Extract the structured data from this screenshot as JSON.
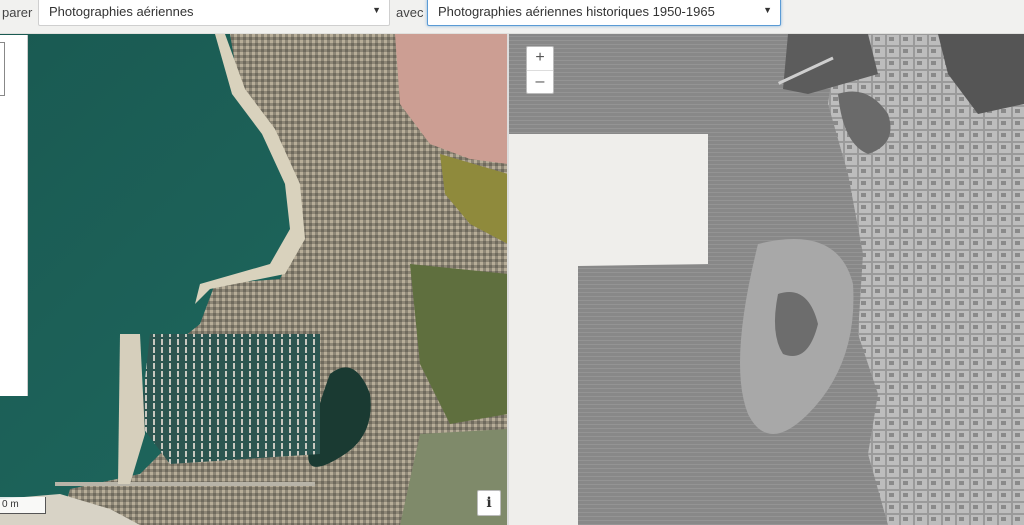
{
  "toolbar": {
    "compare_label": "parer",
    "with_label": "avec",
    "left_layer": {
      "value": "Photographies aériennes"
    },
    "right_layer": {
      "value": "Photographies aériennes historiques 1950-1965"
    }
  },
  "map_controls": {
    "zoom_in": "+",
    "zoom_out": "–",
    "info": "i",
    "scale": "0 m"
  },
  "icons": [
    "dropdown-arrow-icon",
    "zoom-in-icon",
    "zoom-out-icon",
    "info-icon"
  ],
  "colors": {
    "active_select_border": "#5b9bd5",
    "toolbar_bg": "#f1f1ef"
  }
}
